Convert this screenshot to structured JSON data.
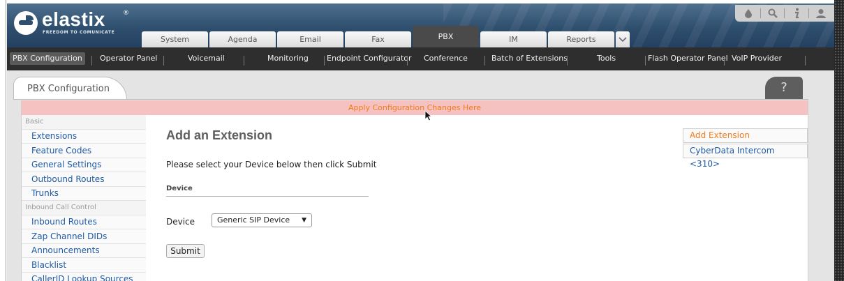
{
  "brand": {
    "name": "elastix",
    "registered": "®",
    "tagline": "FREEDOM TO COMUNICATE"
  },
  "top_icons": [
    "drop-icon",
    "search-icon",
    "info-icon",
    "user-icon"
  ],
  "tabs": [
    {
      "label": "System",
      "active": false
    },
    {
      "label": "Agenda",
      "active": false
    },
    {
      "label": "Email",
      "active": false
    },
    {
      "label": "Fax",
      "active": false
    },
    {
      "label": "PBX",
      "active": true
    },
    {
      "label": "IM",
      "active": false
    },
    {
      "label": "Reports",
      "active": false
    }
  ],
  "submenu": [
    {
      "label": "PBX Configuration",
      "active": true
    },
    {
      "label": "Operator Panel"
    },
    {
      "label": "Voicemail"
    },
    {
      "label": "Monitoring"
    },
    {
      "label": "Endpoint Configurator"
    },
    {
      "label": "Conference"
    },
    {
      "label": "Batch of Extensions"
    },
    {
      "label": "Tools"
    },
    {
      "label": "Flash Operator Panel"
    },
    {
      "label": "VoIP Provider"
    }
  ],
  "panel": {
    "tab_label": "PBX Configuration",
    "help": "?"
  },
  "apply_bar": "Apply Configuration Changes Here",
  "sidebar": [
    {
      "type": "heading",
      "label": "Basic"
    },
    {
      "type": "link",
      "label": "Extensions"
    },
    {
      "type": "link",
      "label": "Feature Codes"
    },
    {
      "type": "link",
      "label": "General Settings"
    },
    {
      "type": "link",
      "label": "Outbound Routes"
    },
    {
      "type": "link",
      "label": "Trunks"
    },
    {
      "type": "heading",
      "label": "Inbound Call Control"
    },
    {
      "type": "link",
      "label": "Inbound Routes"
    },
    {
      "type": "link",
      "label": "Zap Channel DIDs"
    },
    {
      "type": "link",
      "label": "Announcements"
    },
    {
      "type": "link",
      "label": "Blacklist"
    },
    {
      "type": "link",
      "label": "CallerID Lookup Sources"
    }
  ],
  "main": {
    "title": "Add an Extension",
    "instruction": "Please select your Device below then click Submit",
    "section": "Device",
    "device_label": "Device",
    "device_value": "Generic SIP Device",
    "submit_label": "Submit"
  },
  "right_box": [
    {
      "label": "Add Extension",
      "active": true
    },
    {
      "label": "CyberData Intercom <310>",
      "active": false
    }
  ],
  "colors": {
    "header_blue": "#2f4f6e",
    "apply_bar_bg": "#f6c1c1",
    "accent_orange": "#f07c1c",
    "link_blue": "#1f5aa5",
    "submenu_bg": "#2e2e2e"
  }
}
